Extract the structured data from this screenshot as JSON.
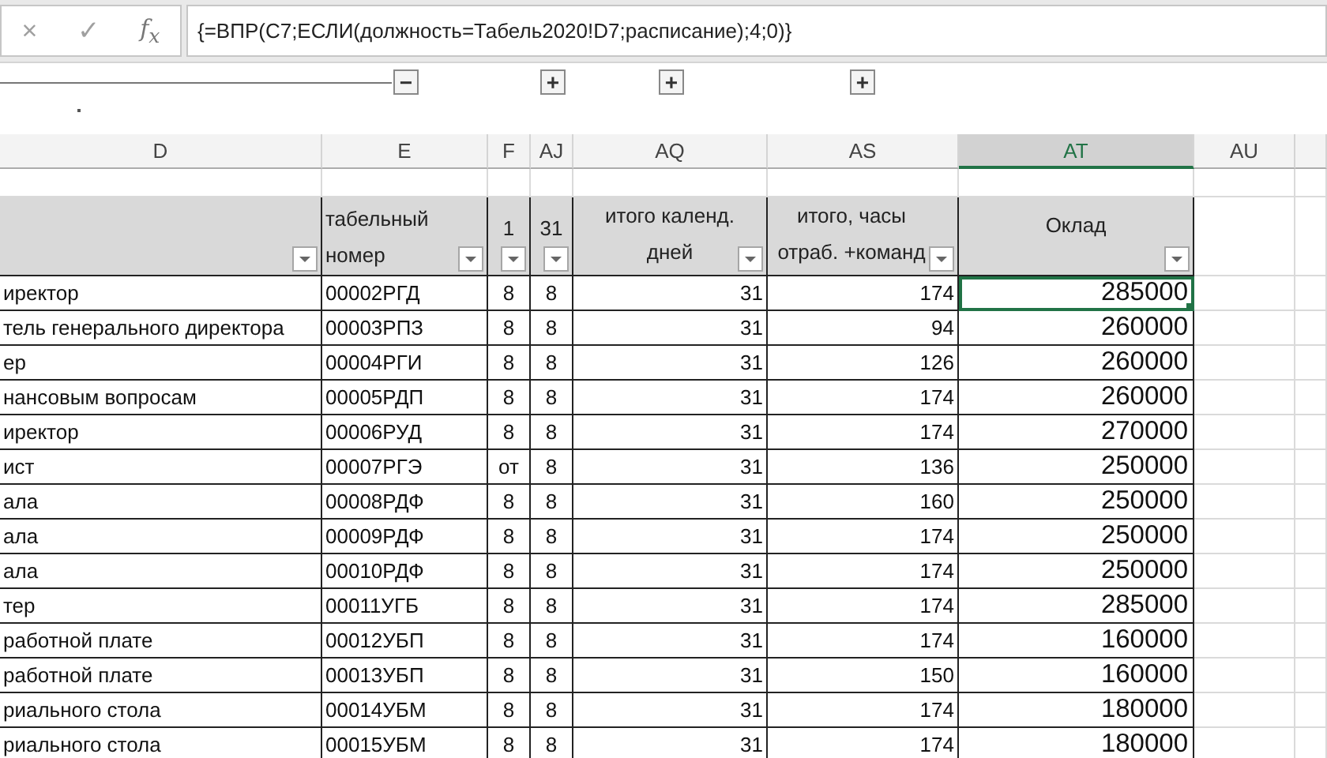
{
  "formula_bar": {
    "cancel_symbol": "×",
    "enter_symbol": "✓",
    "function_label": "f$_{x}$",
    "formula": "{=ВПР(C7;ЕСЛИ(должность=Табель2020!D7;расписание);4;0)}"
  },
  "outline": {
    "collapse": {
      "symbol": "−"
    },
    "expand": [
      {
        "symbol": "+"
      },
      {
        "symbol": "+"
      },
      {
        "symbol": "+"
      }
    ]
  },
  "columns": [
    {
      "letter": "D",
      "selected": false
    },
    {
      "letter": "E",
      "selected": false
    },
    {
      "letter": "F",
      "selected": false
    },
    {
      "letter": "AJ",
      "selected": false
    },
    {
      "letter": "AQ",
      "selected": false
    },
    {
      "letter": "AS",
      "selected": false
    },
    {
      "letter": "AT",
      "selected": true
    },
    {
      "letter": "AU",
      "selected": false
    }
  ],
  "header_row": [
    {
      "filter": true
    },
    {
      "text": "табельный\nномер",
      "filter": true
    },
    {
      "text": "1",
      "filter": true
    },
    {
      "text": "31",
      "filter": true
    },
    {
      "text": "итого календ.\nдней",
      "filter": true
    },
    {
      "text": "итого, часы\nотраб. +команд",
      "filter": true
    },
    {
      "text": "Оклад",
      "filter": true
    }
  ],
  "rows": [
    {
      "cells": [
        "иректор",
        "00002РГД",
        "8",
        "8",
        "31",
        "174",
        "285000"
      ],
      "selected": true
    },
    {
      "cells": [
        "тель генерального директора",
        "00003РПЗ",
        "8",
        "8",
        "31",
        "94",
        "260000"
      ],
      "selected": false
    },
    {
      "cells": [
        "ер",
        "00004РГИ",
        "8",
        "8",
        "31",
        "126",
        "260000"
      ],
      "selected": false
    },
    {
      "cells": [
        "нансовым вопросам",
        "00005РДП",
        "8",
        "8",
        "31",
        "174",
        "260000"
      ],
      "selected": false
    },
    {
      "cells": [
        "иректор",
        "00006РУД",
        "8",
        "8",
        "31",
        "174",
        "270000"
      ],
      "selected": false
    },
    {
      "cells": [
        "ист",
        "00007РГЭ",
        "от",
        "8",
        "31",
        "136",
        "250000"
      ],
      "selected": false
    },
    {
      "cells": [
        "ала",
        "00008РДФ",
        "8",
        "8",
        "31",
        "160",
        "250000"
      ],
      "selected": false
    },
    {
      "cells": [
        "ала",
        "00009РДФ",
        "8",
        "8",
        "31",
        "174",
        "250000"
      ],
      "selected": false
    },
    {
      "cells": [
        "ала",
        "00010РДФ",
        "8",
        "8",
        "31",
        "174",
        "250000"
      ],
      "selected": false
    },
    {
      "cells": [
        "тер",
        "00011УГБ",
        "8",
        "8",
        "31",
        "174",
        "285000"
      ],
      "selected": false
    },
    {
      "cells": [
        "работной плате",
        "00012УБП",
        "8",
        "8",
        "31",
        "174",
        "160000"
      ],
      "selected": false
    },
    {
      "cells": [
        "работной плате",
        "00013УБП",
        "8",
        "8",
        "31",
        "150",
        "160000"
      ],
      "selected": false
    },
    {
      "cells": [
        "риального стола",
        "00014УБМ",
        "8",
        "8",
        "31",
        "174",
        "180000"
      ],
      "selected": false
    },
    {
      "cells": [
        "риального стола",
        "00015УБМ",
        "8",
        "8",
        "31",
        "174",
        "180000"
      ],
      "selected": false
    }
  ]
}
